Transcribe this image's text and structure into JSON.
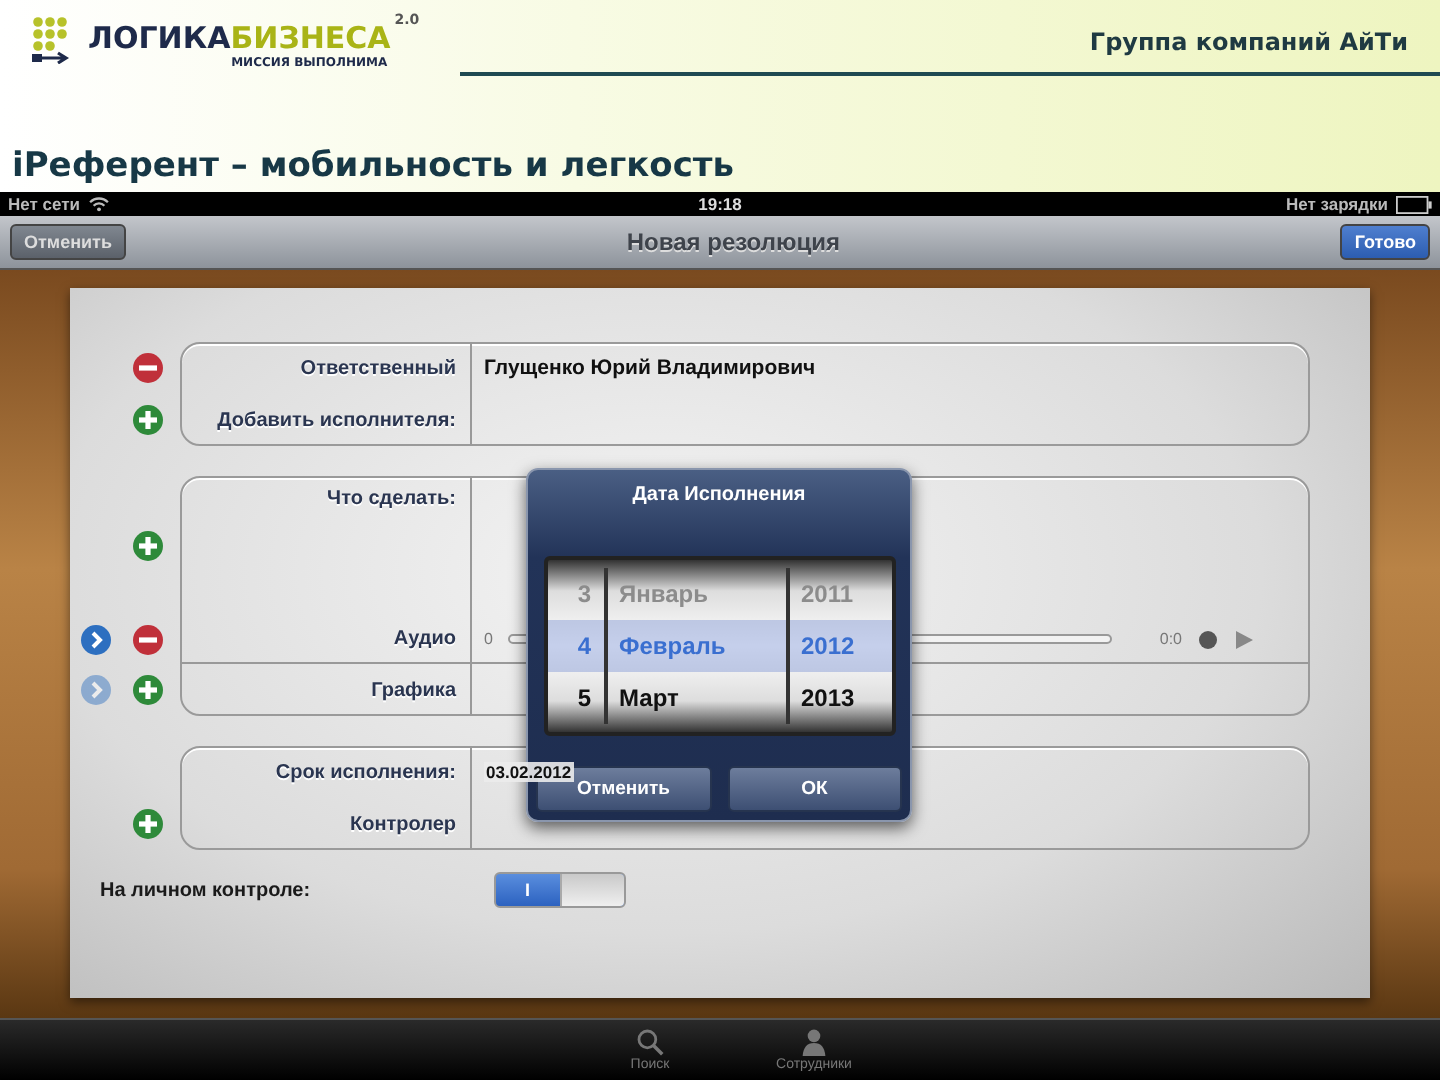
{
  "slide": {
    "logo": {
      "wordmark": [
        "ЛОГИКА",
        "БИЗНЕСА"
      ],
      "version": "2.0",
      "tagline": "МИССИЯ ВЫПОЛНИМА"
    },
    "company": "Группа компаний АйТи",
    "title": "iРеферент – мобильность и легкость"
  },
  "status_bar": {
    "carrier": "Нет сети",
    "time": "19:18",
    "battery": "Нет зарядки"
  },
  "nav_bar": {
    "left_button": "Отменить",
    "title": "Новая резолюция",
    "right_button": "Готово"
  },
  "form": {
    "groups": [
      {
        "rows": [
          {
            "kind": "text",
            "label": "Ответственный",
            "value": "Глущенко Юрий Владимирович",
            "icons": [
              {
                "kind": "remove"
              }
            ]
          },
          {
            "kind": "text",
            "label": "Добавить исполнителя:",
            "icons": [
              {
                "kind": "add"
              }
            ]
          }
        ]
      },
      {
        "rows": [
          {
            "kind": "multiline",
            "label": "Что сделать:",
            "icons": [
              {
                "kind": "add"
              }
            ]
          },
          {
            "kind": "audio",
            "label": "Аудио",
            "icons": [
              {
                "kind": "disclosure",
                "disabled": false
              },
              {
                "kind": "remove"
              }
            ],
            "start_reading": "0",
            "end_reading": "0:0",
            "level": 0
          },
          {
            "kind": "text",
            "label": "Графика",
            "icons": [
              {
                "kind": "disclosure",
                "disabled": true
              },
              {
                "kind": "add"
              }
            ]
          }
        ]
      },
      {
        "rows": [
          {
            "kind": "text",
            "label": "Срок исполнения:",
            "value": "03.02.2012"
          },
          {
            "kind": "text",
            "label": "Контролер",
            "icons": [
              {
                "kind": "add"
              }
            ]
          }
        ]
      }
    ],
    "personal_control": {
      "label": "На личном контроле:",
      "on": true,
      "on_label": "I"
    }
  },
  "date_picker": {
    "title": "Дата Исполнения",
    "rows": [
      {
        "day": "3",
        "month": "Январь",
        "year": "2011",
        "selected": false,
        "disabled": true
      },
      {
        "day": "4",
        "month": "Февраль",
        "year": "2012",
        "selected": true,
        "disabled": false
      },
      {
        "day": "5",
        "month": "Март",
        "year": "2013",
        "selected": false,
        "disabled": false
      }
    ],
    "buttons": [
      "Отменить",
      "ОК"
    ]
  },
  "tab_bar": {
    "items": [
      {
        "kind": "search",
        "label": "Поиск"
      },
      {
        "kind": "person",
        "label": "Сотрудники"
      }
    ]
  }
}
